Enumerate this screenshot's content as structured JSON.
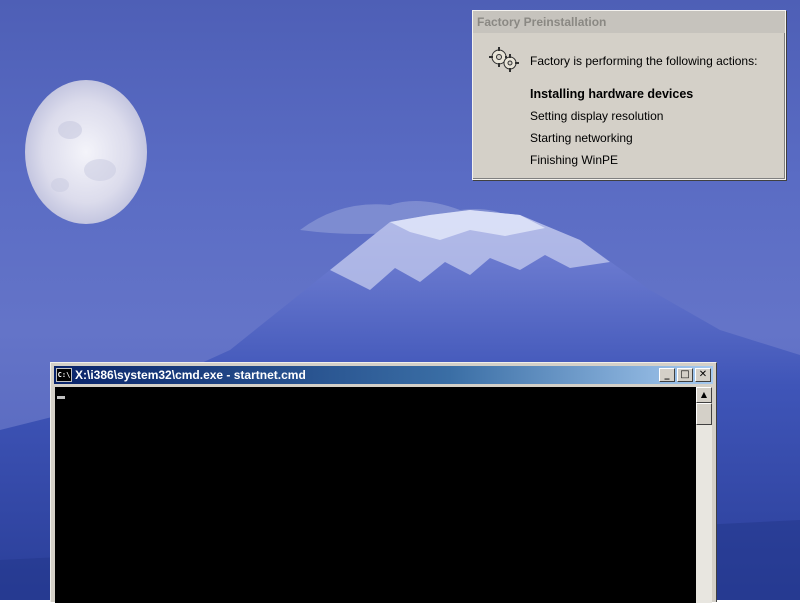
{
  "factory_dialog": {
    "title": "Factory Preinstallation",
    "intro": "Factory is performing the following actions:",
    "icon": "gears-icon",
    "actions": [
      {
        "label": "Installing hardware devices",
        "active": true
      },
      {
        "label": "Setting display resolution",
        "active": false
      },
      {
        "label": "Starting networking",
        "active": false
      },
      {
        "label": "Finishing WinPE",
        "active": false
      }
    ]
  },
  "cmd_window": {
    "title": "X:\\i386\\system32\\cmd.exe - startnet.cmd",
    "icon_label": "C:\\",
    "minimize_glyph": "_",
    "maximize_glyph": "□",
    "close_glyph": "✕",
    "scroll_up_glyph": "▲"
  },
  "colors": {
    "titlebar_start": "#0a246a",
    "titlebar_end": "#a6caf0",
    "dialog_bg": "#d4d0c8",
    "console_bg": "#000000"
  }
}
